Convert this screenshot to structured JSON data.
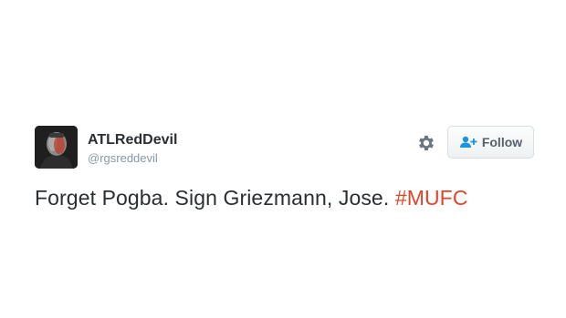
{
  "tweet": {
    "display_name": "ATLRedDevil",
    "username": "@rgsreddevil",
    "follow_label": "Follow",
    "text": "Forget Pogba. Sign Griezmann, Jose. ",
    "hashtag": "#MUFC"
  },
  "icons": {
    "avatar": "profile-photo",
    "settings": "gear-icon",
    "follow": "add-user-icon"
  },
  "colors": {
    "hashtag": "#e0452a",
    "follow_icon": "#1b95e0",
    "name": "#292f33",
    "username": "#8899a6"
  }
}
